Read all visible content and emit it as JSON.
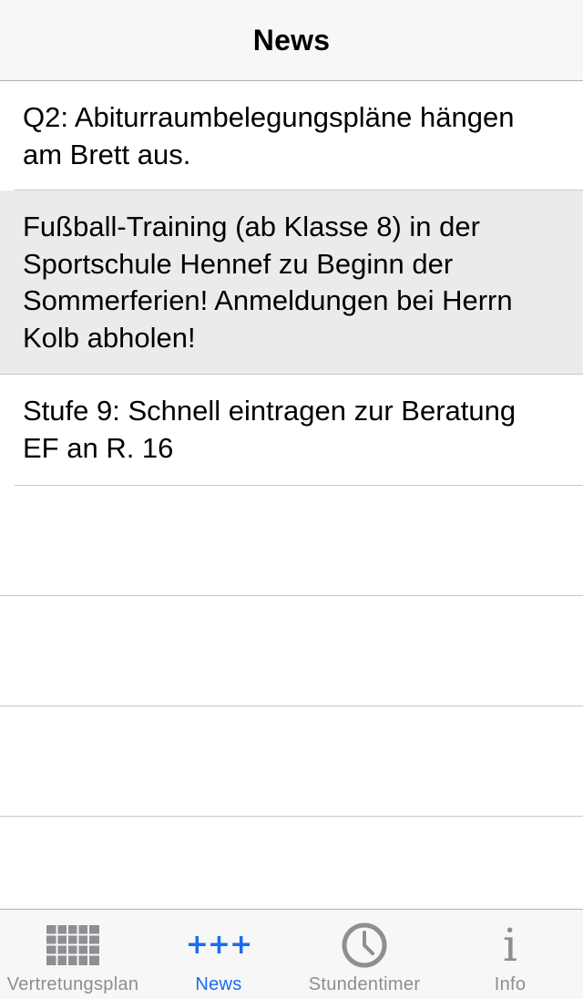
{
  "navbar": {
    "title": "News"
  },
  "news": {
    "items": [
      {
        "text": "Q2: Abiturraumbelegungspläne hängen am Brett aus."
      },
      {
        "text": "Fußball-Training (ab Klasse 8) in der Sportschule Hennef zu Beginn der Sommerferien! Anmeldungen bei Herrn Kolb abholen!"
      },
      {
        "text": "Stufe 9: Schnell eintragen zur Beratung EF an R. 16"
      }
    ]
  },
  "tabbar": {
    "tabs": [
      {
        "label": "Vertretungsplan",
        "icon": "grid-icon"
      },
      {
        "label": "News",
        "icon": "plus-icon",
        "glyph": "+++"
      },
      {
        "label": "Stundentimer",
        "icon": "clock-icon"
      },
      {
        "label": "Info",
        "icon": "info-icon",
        "glyph": "i"
      }
    ],
    "active_color": "#1a6cf0",
    "inactive_color": "#8e8e93"
  }
}
